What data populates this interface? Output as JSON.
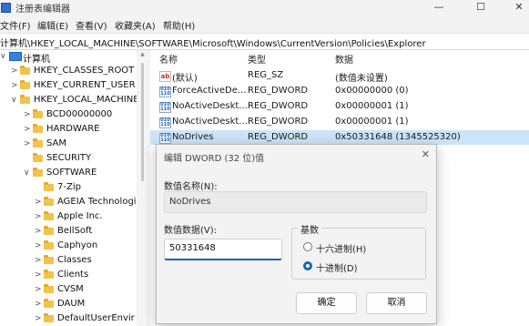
{
  "window": {
    "title": "注册表编辑器",
    "minimize": "—",
    "maximize": "☐",
    "close": "✕"
  },
  "menu": [
    "文件(F)",
    "编辑(E)",
    "查看(V)",
    "收藏夹(A)",
    "帮助(H)"
  ],
  "address": "计算机\\HKEY_LOCAL_MACHINE\\SOFTWARE\\Microsoft\\Windows\\CurrentVersion\\Policies\\Explorer",
  "tree": [
    {
      "label": "计算机",
      "chevron": "∨",
      "icon": "computer-icon"
    },
    {
      "label": "HKEY_CLASSES_ROOT",
      "chevron": ">",
      "icon": "folder-icon"
    },
    {
      "label": "HKEY_CURRENT_USER",
      "chevron": ">",
      "icon": "folder-icon"
    },
    {
      "label": "HKEY_LOCAL_MACHINE",
      "chevron": "∨",
      "icon": "folder-icon"
    },
    {
      "label": "BCD00000000",
      "chevron": ">",
      "icon": "folder-icon"
    },
    {
      "label": "HARDWARE",
      "chevron": ">",
      "icon": "folder-icon"
    },
    {
      "label": "SAM",
      "chevron": ">",
      "icon": "folder-icon"
    },
    {
      "label": "SECURITY",
      "chevron": "",
      "icon": "folder-icon"
    },
    {
      "label": "SOFTWARE",
      "chevron": "∨",
      "icon": "folder-icon"
    },
    {
      "label": "7-Zip",
      "chevron": "",
      "icon": "folder-icon"
    },
    {
      "label": "AGEIA Technologie",
      "chevron": ">",
      "icon": "folder-icon"
    },
    {
      "label": "Apple Inc.",
      "chevron": ">",
      "icon": "folder-icon"
    },
    {
      "label": "BellSoft",
      "chevron": ">",
      "icon": "folder-icon"
    },
    {
      "label": "Caphyon",
      "chevron": ">",
      "icon": "folder-icon"
    },
    {
      "label": "Classes",
      "chevron": ">",
      "icon": "folder-icon"
    },
    {
      "label": "Clients",
      "chevron": ">",
      "icon": "folder-icon"
    },
    {
      "label": "CVSM",
      "chevron": ">",
      "icon": "folder-icon"
    },
    {
      "label": "DAUM",
      "chevron": ">",
      "icon": "folder-icon"
    },
    {
      "label": "DefaultUserEnvir",
      "chevron": ">",
      "icon": "folder-icon"
    }
  ],
  "columns": {
    "name": "名称",
    "type": "类型",
    "data": "数据"
  },
  "values": [
    {
      "name": "(默认)",
      "type": "REG_SZ",
      "data": "(数值未设置)",
      "icon": "string-value-icon"
    },
    {
      "name": "ForceActiveDe...",
      "type": "REG_DWORD",
      "data": "0x00000000 (0)",
      "icon": "binary-value-icon"
    },
    {
      "name": "NoActiveDeskt...",
      "type": "REG_DWORD",
      "data": "0x00000001 (1)",
      "icon": "binary-value-icon"
    },
    {
      "name": "NoActiveDeskt...",
      "type": "REG_DWORD",
      "data": "0x00000001 (1)",
      "icon": "binary-value-icon"
    },
    {
      "name": "NoDrives",
      "type": "REG_DWORD",
      "data": "0x50331648 (1345525320)",
      "icon": "binary-value-icon"
    }
  ],
  "dialog": {
    "title": "编辑 DWORD (32 位)值",
    "close": "✕",
    "name_label": "数值名称(N):",
    "name_value": "NoDrives",
    "data_label": "数值数据(V):",
    "data_value": "50331648",
    "base_label": "基数",
    "hex_label": "十六进制(H)",
    "dec_label": "十进制(D)",
    "selected_base": "decimal",
    "ok_label": "确定",
    "cancel_label": "取消"
  }
}
